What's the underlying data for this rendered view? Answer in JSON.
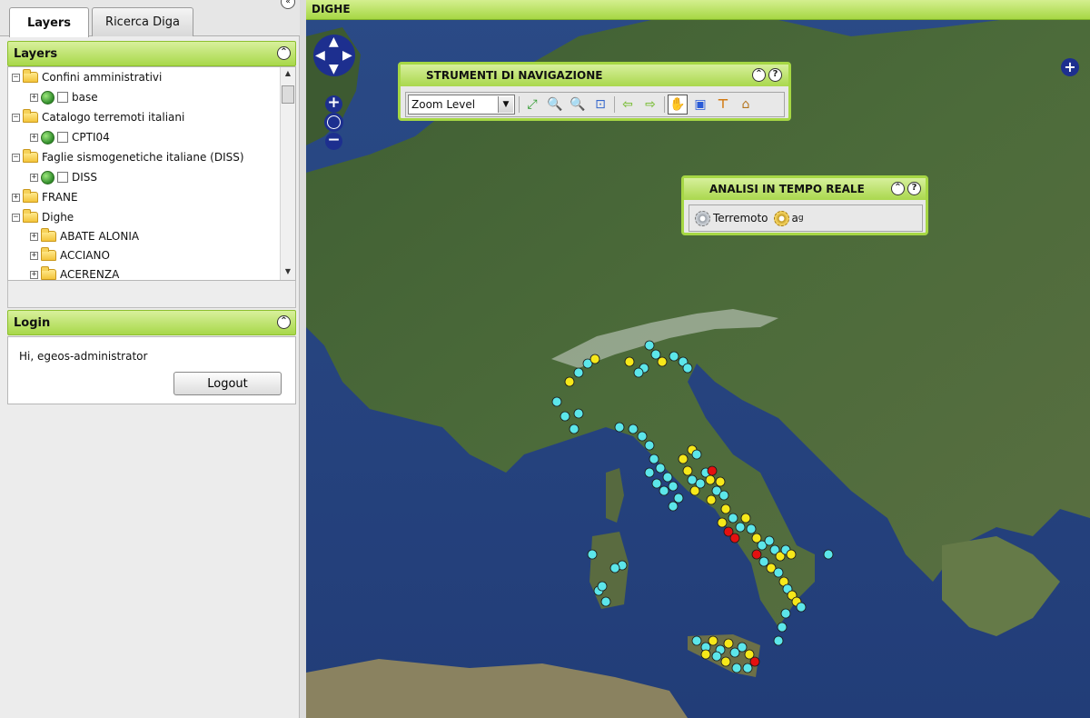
{
  "left_panel": {
    "tabs": [
      {
        "label": "Layers",
        "active": true
      },
      {
        "label": "Ricerca Diga",
        "active": false
      }
    ],
    "layers_panel": {
      "title": "Layers",
      "tree": [
        {
          "label": "Confini amministrativi",
          "type": "folder",
          "expanded": true
        },
        {
          "label": "base",
          "type": "layer"
        },
        {
          "label": "Catalogo terremoti italiani",
          "type": "folder",
          "expanded": true
        },
        {
          "label": "CPTI04",
          "type": "layer"
        },
        {
          "label": "Faglie sismogenetiche italiane (DISS)",
          "type": "folder",
          "expanded": true
        },
        {
          "label": "DISS",
          "type": "layer"
        },
        {
          "label": "FRANE",
          "type": "folder",
          "expanded": false
        },
        {
          "label": "Dighe",
          "type": "folder",
          "expanded": true
        },
        {
          "label": "ABATE ALONIA",
          "type": "folder",
          "expanded": false
        },
        {
          "label": "ACCIANO",
          "type": "folder",
          "expanded": false
        },
        {
          "label": "ACERENZA",
          "type": "folder",
          "expanded": false
        }
      ]
    },
    "login_panel": {
      "title": "Login",
      "greeting": "Hi, egeos-administrator",
      "logout_label": "Logout"
    }
  },
  "map": {
    "title": "DIGHE",
    "nav_tools": {
      "title": "STRUMENTI DI NAVIGAZIONE",
      "zoom_select_value": "Zoom Level"
    },
    "realtime_tools": {
      "title": "ANALISI IN TEMPO REALE",
      "btn_earthquake": "Terremoto",
      "btn_ag_main": "a",
      "btn_ag_sub": "g"
    }
  },
  "colors": {
    "panel_green": "#a6d744",
    "dam_cyan": "#5ce6ea",
    "dam_yellow": "#f6e81a",
    "dam_red": "#e41010",
    "nav_blue": "#1d2f8f"
  }
}
